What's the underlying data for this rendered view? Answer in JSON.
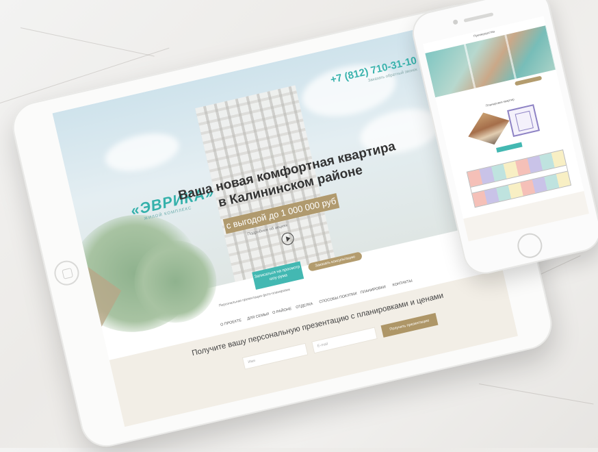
{
  "tablet_site": {
    "phone_number": "+7 (812) 710-31-10",
    "phone_caption": "Заказать обратный звонок",
    "logo_text": "«ЭВРИКА»",
    "logo_sub": "ЖИЛОЙ КОМПЛЕКС",
    "headline_line1": "Ваша новая комфортная квартира",
    "headline_line2": "в Калининском районе",
    "benefit": "с выгодой до 1 000 000 руб",
    "benefit_sub": "Подробнее об акциях",
    "cta_primary": "Записаться на просмотр шоу-рума",
    "cta_secondary": "Заказать консультацию",
    "cta_caption": "Персональная презентация фото-планировок",
    "nav": [
      "О ПРОЕКТЕ",
      "ДЛЯ СЕМЬИ",
      "О РАЙОНЕ",
      "ОТДЕЛКА",
      "СПОСОБЫ ПОКУПКИ",
      "ПЛАНИРОВКИ",
      "КОНТАКТЫ"
    ],
    "presentation_title": "Получите вашу персональную презентацию с планировками и ценами",
    "input_name_placeholder": "Имя",
    "input_phone_placeholder": "E-mail",
    "submit_label": "Получить презентацию"
  },
  "phone_site": {
    "title": "Преимущества",
    "section_title": "Планировки квартир"
  },
  "colors": {
    "teal": "#3ab3ad",
    "gold": "#b09a6e",
    "marble": "#eceae7"
  }
}
